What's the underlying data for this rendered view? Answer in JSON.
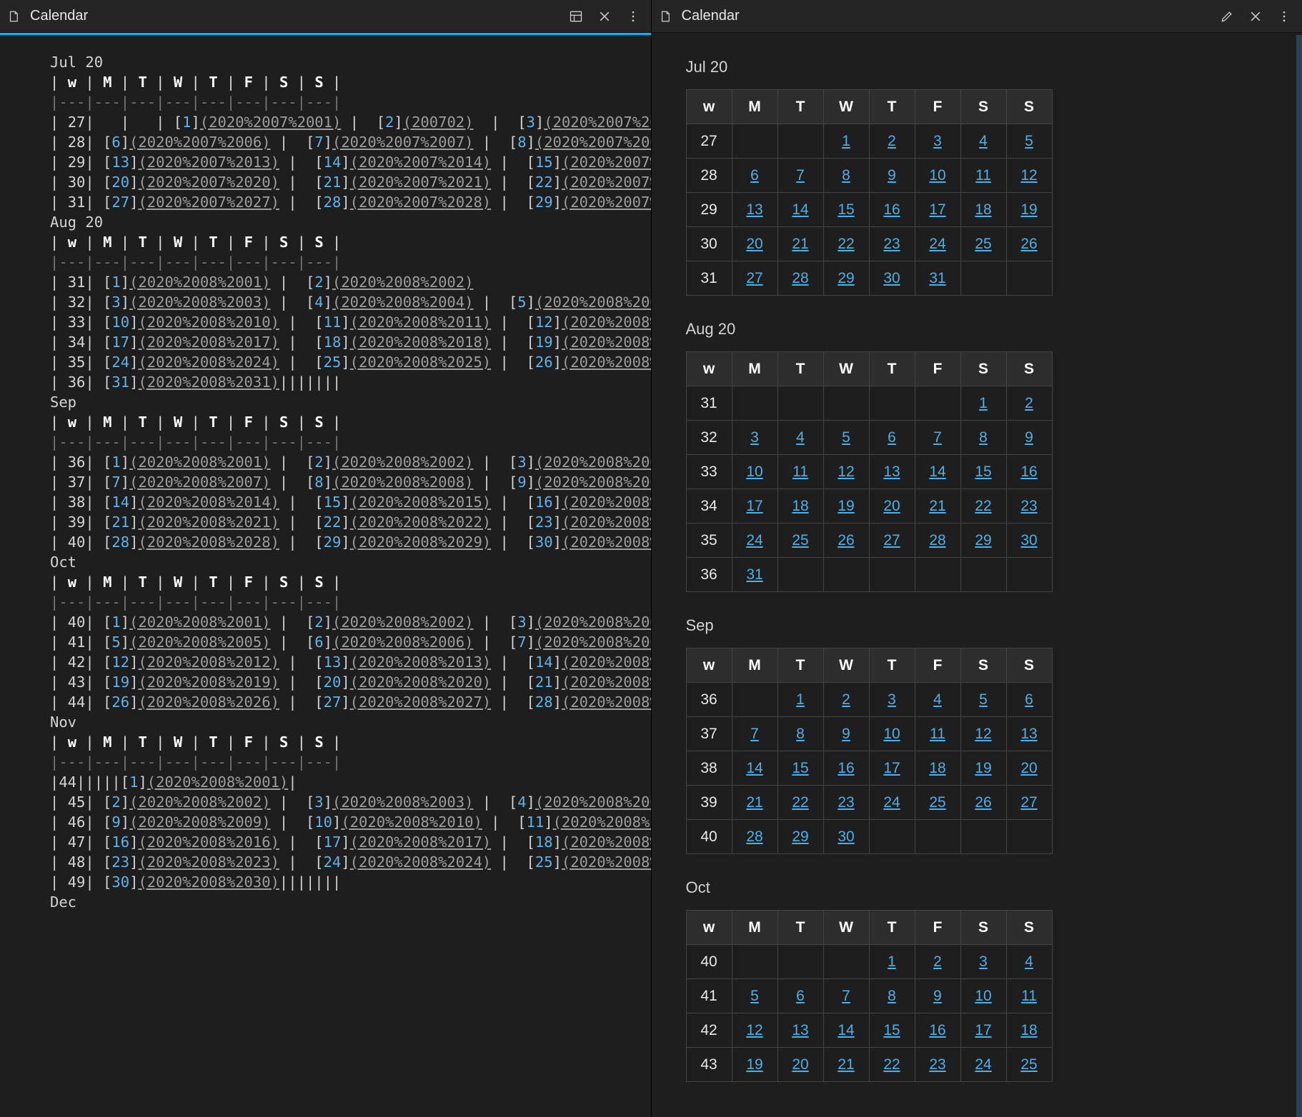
{
  "left": {
    "title": "Calendar",
    "months": [
      {
        "name": "Jul 20",
        "linkPrefix": "2020%2007%20",
        "weeks": [
          {
            "wk": "27",
            "days": [
              "",
              "",
              "1",
              "2",
              "",
              "3",
              ""
            ],
            "special": "jul27"
          },
          {
            "wk": "28",
            "days": [
              "6",
              "",
              "7",
              "",
              "8",
              "",
              ""
            ]
          },
          {
            "wk": "29",
            "days": [
              "13",
              "",
              "14",
              "",
              "15",
              "",
              ""
            ]
          },
          {
            "wk": "30",
            "days": [
              "20",
              "",
              "21",
              "",
              "22",
              "",
              ""
            ]
          },
          {
            "wk": "31",
            "days": [
              "27",
              "",
              "28",
              "",
              "29",
              "",
              ""
            ]
          }
        ]
      },
      {
        "name": "Aug 20",
        "linkPrefix": "2020%2008%20",
        "weeks": [
          {
            "wk": "31",
            "days": [
              "",
              "",
              "",
              "1",
              "",
              "2",
              ""
            ]
          },
          {
            "wk": "32",
            "days": [
              "3",
              "",
              "4",
              "",
              "5",
              "",
              ""
            ]
          },
          {
            "wk": "33",
            "days": [
              "10",
              "",
              "11",
              "",
              "12",
              "",
              ""
            ]
          },
          {
            "wk": "34",
            "days": [
              "17",
              "",
              "18",
              "",
              "19",
              "",
              ""
            ]
          },
          {
            "wk": "35",
            "days": [
              "24",
              "",
              "25",
              "",
              "26",
              "",
              ""
            ]
          },
          {
            "wk": "36",
            "days": [
              "31",
              "",
              "",
              "",
              "",
              "",
              ""
            ],
            "trailing": true
          }
        ]
      },
      {
        "name": "Sep",
        "linkPrefix": "2020%2008%20",
        "weeks": [
          {
            "wk": "36",
            "days": [
              "",
              "1",
              "",
              "2",
              "",
              "3",
              ""
            ]
          },
          {
            "wk": "37",
            "days": [
              "7",
              "",
              "8",
              "",
              "9",
              "",
              ""
            ]
          },
          {
            "wk": "38",
            "days": [
              "14",
              "",
              "15",
              "",
              "16",
              "",
              ""
            ]
          },
          {
            "wk": "39",
            "days": [
              "21",
              "",
              "22",
              "",
              "23",
              "",
              ""
            ]
          },
          {
            "wk": "40",
            "days": [
              "28",
              "",
              "29",
              "",
              "30",
              "",
              ""
            ]
          }
        ]
      },
      {
        "name": "Oct",
        "linkPrefix": "2020%2008%20",
        "weeks": [
          {
            "wk": "40",
            "days": [
              "",
              "",
              "",
              "1",
              "",
              "2",
              "",
              "3"
            ]
          },
          {
            "wk": "41",
            "days": [
              "5",
              "",
              "6",
              "",
              "7",
              "",
              ""
            ]
          },
          {
            "wk": "42",
            "days": [
              "12",
              "",
              "13",
              "",
              "14",
              "",
              ""
            ]
          },
          {
            "wk": "43",
            "days": [
              "19",
              "",
              "20",
              "",
              "21",
              "",
              ""
            ]
          },
          {
            "wk": "44",
            "days": [
              "26",
              "",
              "27",
              "",
              "28",
              "",
              ""
            ]
          }
        ]
      },
      {
        "name": "Nov",
        "linkPrefix": "2020%2008%20",
        "weeks": [
          {
            "wk": "44",
            "days": [
              "",
              "",
              "",
              "",
              "",
              "1",
              ""
            ],
            "single": true
          },
          {
            "wk": "45",
            "days": [
              "2",
              "",
              "3",
              "",
              "4",
              "",
              ""
            ]
          },
          {
            "wk": "46",
            "days": [
              "9",
              "",
              "10",
              "",
              "11",
              "",
              ""
            ]
          },
          {
            "wk": "47",
            "days": [
              "16",
              "",
              "17",
              "",
              "18",
              "",
              ""
            ]
          },
          {
            "wk": "48",
            "days": [
              "23",
              "",
              "24",
              "",
              "25",
              "",
              ""
            ]
          },
          {
            "wk": "49",
            "days": [
              "30",
              "",
              "",
              "",
              "",
              "",
              ""
            ],
            "trailing": true
          }
        ]
      },
      {
        "name": "Dec",
        "linkPrefix": "2020%2008%20",
        "weeks": []
      }
    ],
    "headerCols": [
      "w",
      "M",
      "T",
      "W",
      "T",
      "F",
      "S",
      "S"
    ],
    "separator": "|---|---|---|---|---|---|---|---|"
  },
  "right": {
    "title": "Calendar",
    "headerCols": [
      "w",
      "M",
      "T",
      "W",
      "T",
      "F",
      "S",
      "S"
    ],
    "months": [
      {
        "name": "Jul 20",
        "rows": [
          {
            "wk": "27",
            "cells": [
              "",
              "",
              "1",
              "2",
              "3",
              "4",
              "5"
            ]
          },
          {
            "wk": "28",
            "cells": [
              "6",
              "7",
              "8",
              "9",
              "10",
              "11",
              "12"
            ]
          },
          {
            "wk": "29",
            "cells": [
              "13",
              "14",
              "15",
              "16",
              "17",
              "18",
              "19"
            ]
          },
          {
            "wk": "30",
            "cells": [
              "20",
              "21",
              "22",
              "23",
              "24",
              "25",
              "26"
            ]
          },
          {
            "wk": "31",
            "cells": [
              "27",
              "28",
              "29",
              "30",
              "31",
              "",
              ""
            ]
          }
        ]
      },
      {
        "name": "Aug 20",
        "rows": [
          {
            "wk": "31",
            "cells": [
              "",
              "",
              "",
              "",
              "",
              "1",
              "2"
            ]
          },
          {
            "wk": "32",
            "cells": [
              "3",
              "4",
              "5",
              "6",
              "7",
              "8",
              "9"
            ]
          },
          {
            "wk": "33",
            "cells": [
              "10",
              "11",
              "12",
              "13",
              "14",
              "15",
              "16"
            ]
          },
          {
            "wk": "34",
            "cells": [
              "17",
              "18",
              "19",
              "20",
              "21",
              "22",
              "23"
            ]
          },
          {
            "wk": "35",
            "cells": [
              "24",
              "25",
              "26",
              "27",
              "28",
              "29",
              "30"
            ]
          },
          {
            "wk": "36",
            "cells": [
              "31",
              "",
              "",
              "",
              "",
              "",
              ""
            ]
          }
        ]
      },
      {
        "name": "Sep",
        "rows": [
          {
            "wk": "36",
            "cells": [
              "",
              "1",
              "2",
              "3",
              "4",
              "5",
              "6"
            ]
          },
          {
            "wk": "37",
            "cells": [
              "7",
              "8",
              "9",
              "10",
              "11",
              "12",
              "13"
            ]
          },
          {
            "wk": "38",
            "cells": [
              "14",
              "15",
              "16",
              "17",
              "18",
              "19",
              "20"
            ]
          },
          {
            "wk": "39",
            "cells": [
              "21",
              "22",
              "23",
              "24",
              "25",
              "26",
              "27"
            ]
          },
          {
            "wk": "40",
            "cells": [
              "28",
              "29",
              "30",
              "",
              "",
              "",
              ""
            ]
          }
        ]
      },
      {
        "name": "Oct",
        "rows": [
          {
            "wk": "40",
            "cells": [
              "",
              "",
              "",
              "1",
              "2",
              "3",
              "4"
            ]
          },
          {
            "wk": "41",
            "cells": [
              "5",
              "6",
              "7",
              "8",
              "9",
              "10",
              "11"
            ]
          },
          {
            "wk": "42",
            "cells": [
              "12",
              "13",
              "14",
              "15",
              "16",
              "17",
              "18"
            ]
          },
          {
            "wk": "43",
            "cells": [
              "19",
              "20",
              "21",
              "22",
              "23",
              "24",
              "25"
            ]
          }
        ]
      }
    ]
  }
}
